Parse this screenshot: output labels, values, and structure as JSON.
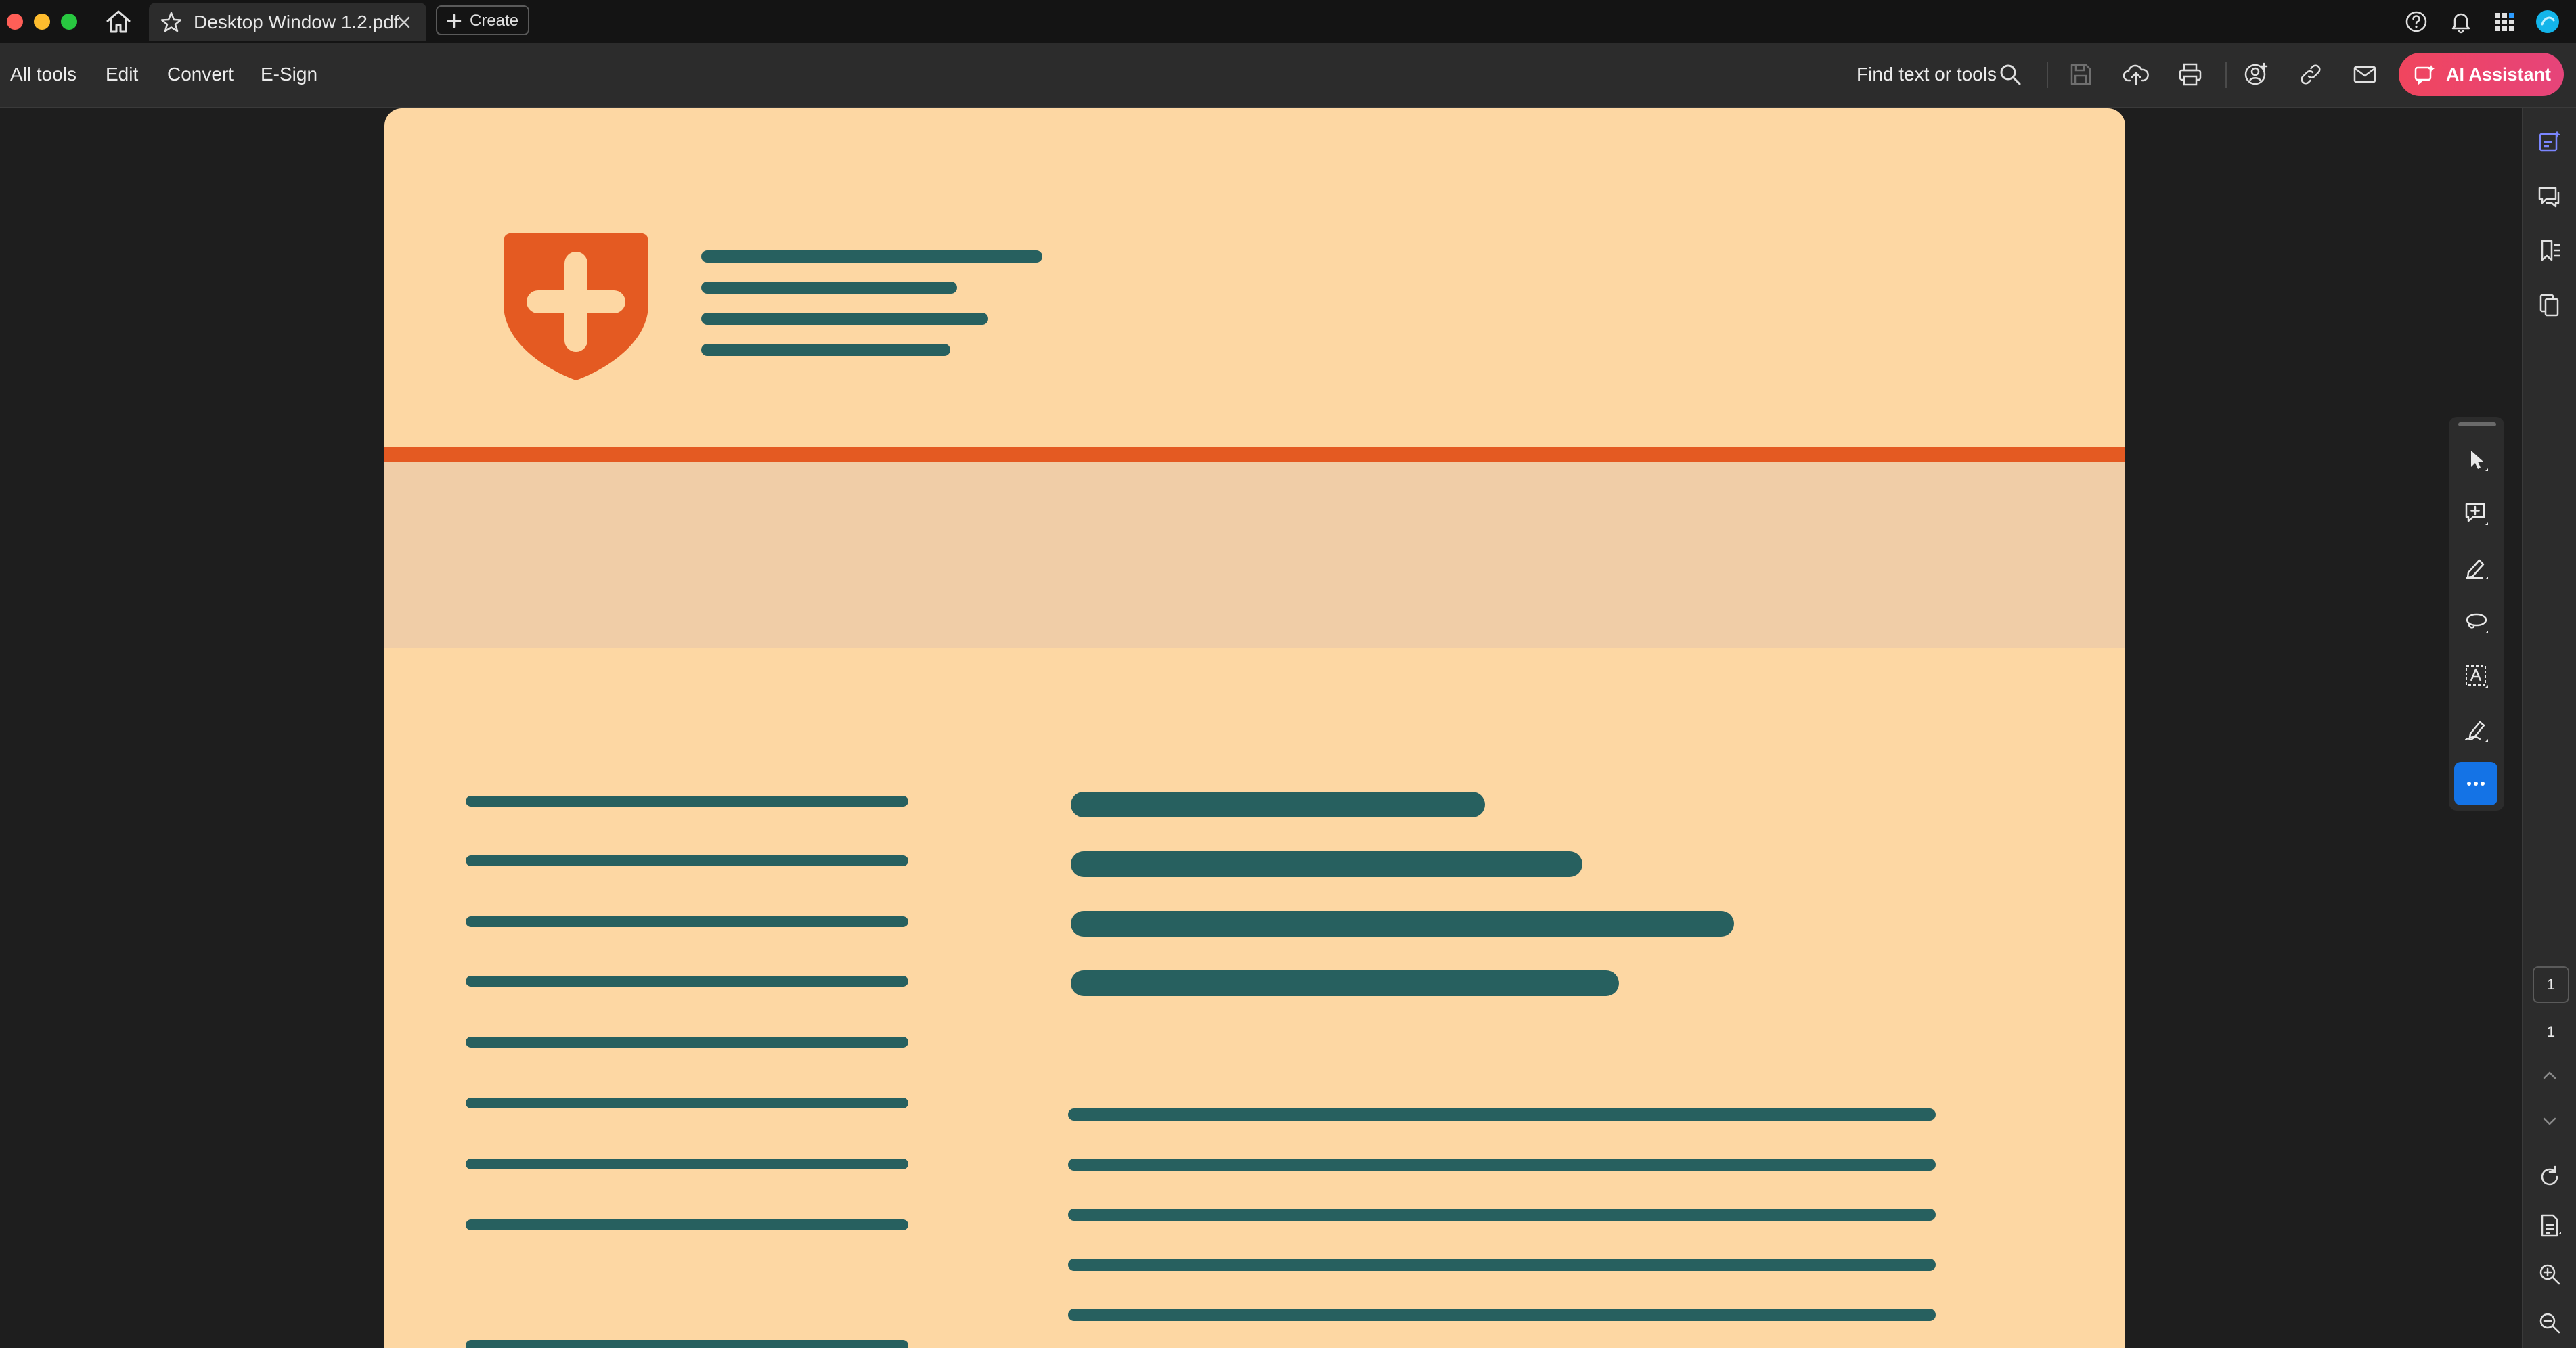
{
  "titlebar": {
    "tab_title": "Desktop Window 1.2.pdf",
    "create_label": "Create",
    "icons": [
      "home-icon",
      "star-icon",
      "close-icon",
      "plus-icon",
      "help-icon",
      "bell-icon",
      "apps-grid-icon",
      "account-avatar-icon"
    ]
  },
  "toolbar": {
    "menu": [
      "All tools",
      "Edit",
      "Convert",
      "E-Sign"
    ],
    "find_label": "Find text or tools",
    "icons": [
      "search-icon",
      "save-icon",
      "upload-cloud-icon",
      "print-icon",
      "share-user-icon",
      "link-icon",
      "mail-icon"
    ],
    "ai_label": "AI Assistant"
  },
  "right_rail": {
    "page_current": "1",
    "page_total": "1",
    "icons": [
      "edit-panel-icon",
      "comments-icon",
      "bookmarks-icon",
      "pages-icon",
      "scroll-up-icon",
      "scroll-down-icon",
      "rotate-icon",
      "page-info-icon",
      "zoom-in-icon",
      "zoom-out-icon"
    ]
  },
  "quick_tools": {
    "icons": [
      "select-cursor-icon",
      "add-comment-icon",
      "highlight-pen-icon",
      "lasso-icon",
      "text-select-icon",
      "sign-icon",
      "more-icon"
    ]
  },
  "colors": {
    "page_background": "#fdd7a3",
    "band": "#f0cda7",
    "divider": "#e45a22",
    "placeholder_bar": "#27605f",
    "ai_button": "#f0455e",
    "more_button": "#1473e6"
  }
}
